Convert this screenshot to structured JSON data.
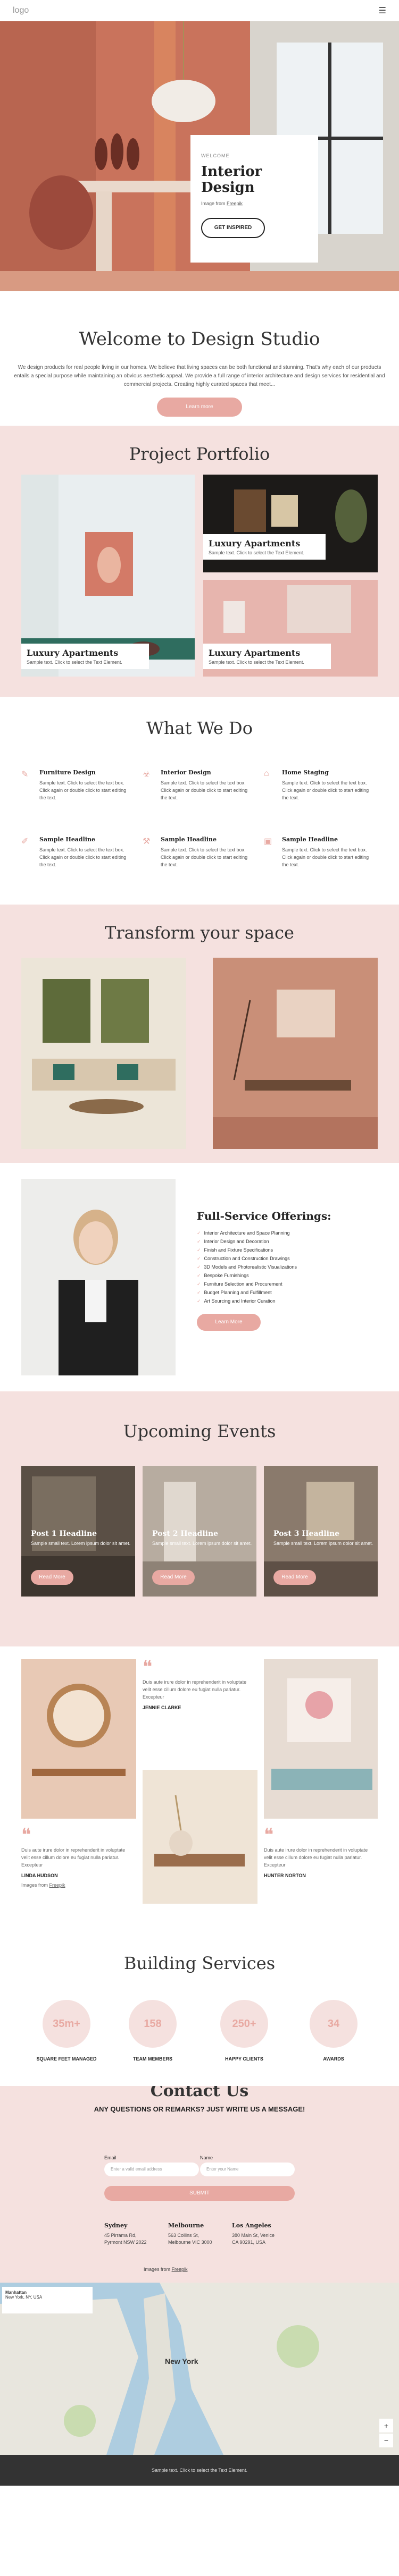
{
  "header": {
    "logo": "logo",
    "menu_icon": "hamburger-icon"
  },
  "hero": {
    "kicker": "WELCOME",
    "title": "Interior Design",
    "image_credit_prefix": "Image from ",
    "image_credit_link": "Freepik",
    "cta": "GET INSPIRED"
  },
  "welcome": {
    "title": "Welcome to Design Studio",
    "body": "We design products for real people living in our homes. We believe that living spaces can be both functional and stunning. That's why each of our products entails a special purpose while maintaining an obvious aesthetic appeal.  We provide a full range of interior architecture and design services for residential and commercial projects. Creating highly curated spaces that meet...",
    "cta": "Learn more"
  },
  "portfolio": {
    "title": "Project Portfolio",
    "items": [
      {
        "title": "Luxury Apartments",
        "text": "Sample text. Click to select the Text Element."
      },
      {
        "title": "Luxury Apartments",
        "text": "Sample text. Click to select the Text Element."
      },
      {
        "title": "Luxury Apartments",
        "text": "Sample text. Click to select the Text Element."
      }
    ]
  },
  "wwd": {
    "title": "What We Do",
    "items": [
      {
        "title": "Furniture Design",
        "text": "Sample text. Click to select the text box. Click again or double click to start editing the text."
      },
      {
        "title": "Interior Design",
        "text": "Sample text. Click to select the text box. Click again or double click to start editing the text."
      },
      {
        "title": "Home Staging",
        "text": "Sample text. Click to select the text box. Click again or double click to start editing the text."
      },
      {
        "title": "Sample Headline",
        "text": "Sample text. Click to select the text box. Click again or double click to start editing the text."
      },
      {
        "title": "Sample Headline",
        "text": "Sample text. Click to select the text box. Click again or double click to start editing the text."
      },
      {
        "title": "Sample Headline",
        "text": "Sample text. Click to select the text box. Click again or double click to start editing the text."
      }
    ]
  },
  "transform": {
    "title": "Transform your space"
  },
  "offer": {
    "title": "Full-Service Offerings:",
    "items": [
      "Interior Architecture and Space Planning",
      "Interior Design and Decoration",
      "Finish and Fixture Specifications",
      "Construction and Construction Drawings",
      "3D Models and Photorealistic Visualizations",
      "Bespoke Furnishings",
      "Furniture Selection and Procurement",
      "Budget Planning and Fulfillment",
      "Art Sourcing and Interior Curation"
    ],
    "cta": "Learn More"
  },
  "events": {
    "title": "Upcoming Events",
    "items": [
      {
        "title": "Post 1 Headline",
        "text": "Sample small text. Lorem ipsum dolor sit amet.",
        "cta": "Read More"
      },
      {
        "title": "Post 2 Headline",
        "text": "Sample small text. Lorem ipsum dolor sit amet.",
        "cta": "Read More"
      },
      {
        "title": "Post 3 Headline",
        "text": "Sample small text. Lorem ipsum dolor sit amet.",
        "cta": "Read More"
      }
    ]
  },
  "testimonials": {
    "items": [
      {
        "text": "Duis aute irure dolor in reprehenderit in voluptate velit esse cillum dolore eu fugiat nulla pariatur. Excepteur",
        "name": "JENNIE CLARKE"
      },
      {
        "text": "Duis aute irure dolor in reprehenderit in voluptate velit esse cillum dolore eu fugiat nulla pariatur. Excepteur",
        "name": "LINDA HUDSON"
      },
      {
        "text": "Duis aute irure dolor in reprehenderit in voluptate velit esse cillum dolore eu fugiat nulla pariatur. Excepteur",
        "name": "HUNTER NORTON"
      }
    ],
    "credit_prefix": "Images from ",
    "credit_link": "Freepik"
  },
  "build": {
    "title": "Building Services",
    "stats": [
      {
        "value": "35m+",
        "label": "SQUARE FEET MANAGED"
      },
      {
        "value": "158",
        "label": "TEAM MEMBERS"
      },
      {
        "value": "250+",
        "label": "HAPPY CLIENTS"
      },
      {
        "value": "34",
        "label": "AWARDS"
      }
    ]
  },
  "contact": {
    "title": "Contact Us",
    "subtitle": "ANY QUESTIONS OR REMARKS? JUST WRITE US A MESSAGE!",
    "email_label": "Email",
    "email_placeholder": "Enter a valid email address",
    "name_label": "Name",
    "name_placeholder": "Enter your Name",
    "submit": "SUBMIT",
    "addresses": [
      {
        "city": "Sydney",
        "lines": [
          "45 Pirrama Rd,",
          "Pyrmont NSW 2022"
        ]
      },
      {
        "city": "Melbourne",
        "lines": [
          "563 Collins St,",
          "Melbourne VIC 3000"
        ]
      },
      {
        "city": "Los Angeles",
        "lines": [
          "380 Main St, Venice",
          "CA 90291, USA"
        ]
      }
    ],
    "images_prefix": "Images from ",
    "images_link": "Freepik"
  },
  "map": {
    "place": "Manhattan",
    "place_sub": "New York, NY, USA",
    "city_label": "New York"
  },
  "footer": {
    "text": "Sample text. Click to select the Text Element."
  },
  "colors": {
    "accent": "#e8a9a2",
    "pink_bg": "#f5e1df",
    "terracotta": "#c46d55"
  }
}
